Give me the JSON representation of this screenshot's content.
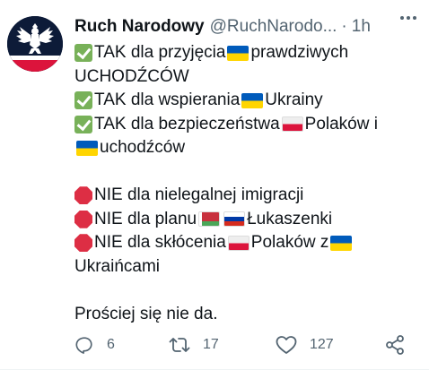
{
  "author": {
    "name": "Ruch Narodowy",
    "handle": "@RuchNarodo...",
    "separator": "·",
    "time": "1h"
  },
  "tweet_lines": [
    {
      "emoji": "check",
      "segments": [
        "TAK dla przyjęcia",
        {
          "flag": "ua"
        },
        "prawdziwych"
      ]
    },
    {
      "segments": [
        "UCHODŹCÓW"
      ]
    },
    {
      "emoji": "check",
      "segments": [
        "TAK dla wspierania",
        {
          "flag": "ua"
        },
        "Ukrainy"
      ]
    },
    {
      "emoji": "check",
      "segments": [
        "TAK dla bezpieczeństwa",
        {
          "flag": "pl"
        },
        "Polaków i"
      ]
    },
    {
      "segments": [
        {
          "flag": "ua"
        },
        "uchodźców"
      ]
    },
    {
      "blank": true
    },
    {
      "emoji": "stop",
      "segments": [
        "NIE dla nielegalnej imigracji"
      ]
    },
    {
      "emoji": "stop",
      "segments": [
        "NIE dla planu",
        {
          "flag": "by"
        },
        {
          "flag": "ru"
        },
        "Łukaszenki"
      ]
    },
    {
      "emoji": "stop",
      "segments": [
        "NIE dla skłócenia",
        {
          "flag": "pl"
        },
        "Polaków z",
        {
          "flag": "ua"
        }
      ]
    },
    {
      "segments": [
        "Ukraińcami"
      ]
    },
    {
      "blank": true
    },
    {
      "segments": [
        "Prościej się nie da."
      ]
    }
  ],
  "actions": {
    "reply": {
      "icon": "reply-icon",
      "count": "6"
    },
    "retweet": {
      "icon": "retweet-icon",
      "count": "17"
    },
    "like": {
      "icon": "heart-icon",
      "count": "127"
    },
    "share": {
      "icon": "share-icon"
    }
  },
  "colors": {
    "text": "#0f1419",
    "secondary": "#536471",
    "avatar_bg": "#0d1b38",
    "check": "#78b159",
    "stop": "#dd2e44",
    "flag_ua_blue": "#005bbb",
    "flag_ua_yellow": "#ffd500",
    "flag_pl_red": "#dc143c"
  }
}
